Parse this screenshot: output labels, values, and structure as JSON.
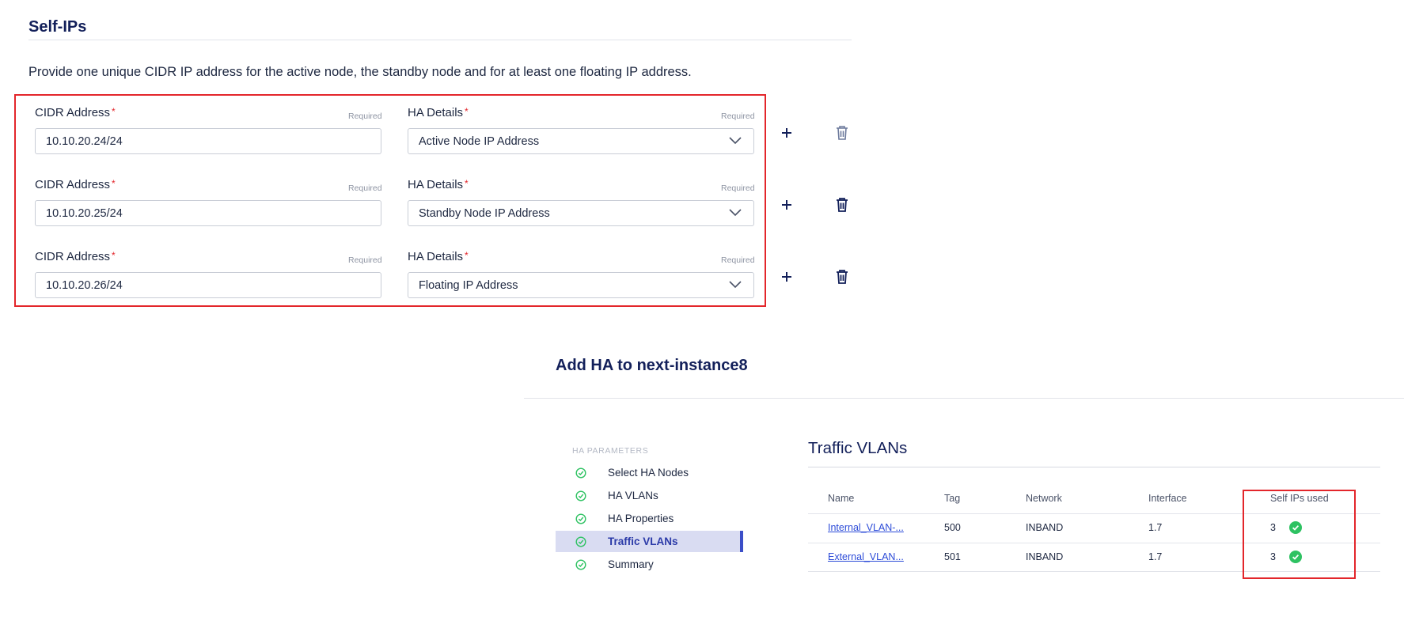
{
  "selfips": {
    "title": "Self-IPs",
    "description": "Provide one unique CIDR IP address for the active node, the standby node and for at least one floating IP address.",
    "rows": [
      {
        "cidr_label": "CIDR Address",
        "cidr_required": "Required",
        "cidr_value": "10.10.20.24/24",
        "ha_label": "HA Details",
        "ha_required": "Required",
        "ha_value": "Active Node IP Address"
      },
      {
        "cidr_label": "CIDR Address",
        "cidr_required": "Required",
        "cidr_value": "10.10.20.25/24",
        "ha_label": "HA Details",
        "ha_required": "Required",
        "ha_value": "Standby Node IP Address"
      },
      {
        "cidr_label": "CIDR Address",
        "cidr_required": "Required",
        "cidr_value": "10.10.20.26/24",
        "ha_label": "HA Details",
        "ha_required": "Required",
        "ha_value": "Floating IP Address"
      }
    ],
    "required_marker": "*",
    "add_icon": "plus-icon",
    "delete_icon": "trash-icon"
  },
  "ha": {
    "title": "Add HA to next-instance8",
    "steps_heading": "HA PARAMETERS",
    "steps": [
      {
        "label": "Select HA Nodes",
        "status": "complete"
      },
      {
        "label": "HA VLANs",
        "status": "complete"
      },
      {
        "label": "HA Properties",
        "status": "complete"
      },
      {
        "label": "Traffic VLANs",
        "status": "active"
      },
      {
        "label": "Summary",
        "status": "complete"
      }
    ],
    "section_title": "Traffic VLANs",
    "table": {
      "columns": [
        "Name",
        "Tag",
        "Network",
        "Interface",
        "Self IPs used"
      ],
      "rows": [
        {
          "name": "Internal_VLAN-...",
          "tag": "500",
          "network": "INBAND",
          "interface": "1.7",
          "self_ips_used": "3",
          "status_icon": "check-circle-icon"
        },
        {
          "name": "External_VLAN...",
          "tag": "501",
          "network": "INBAND",
          "interface": "1.7",
          "self_ips_used": "3",
          "status_icon": "check-circle-icon"
        }
      ]
    }
  },
  "colors": {
    "accent": "#3b4ec8",
    "highlight_frame": "#e3262b",
    "success": "#2ec262",
    "heading": "#13205a"
  }
}
